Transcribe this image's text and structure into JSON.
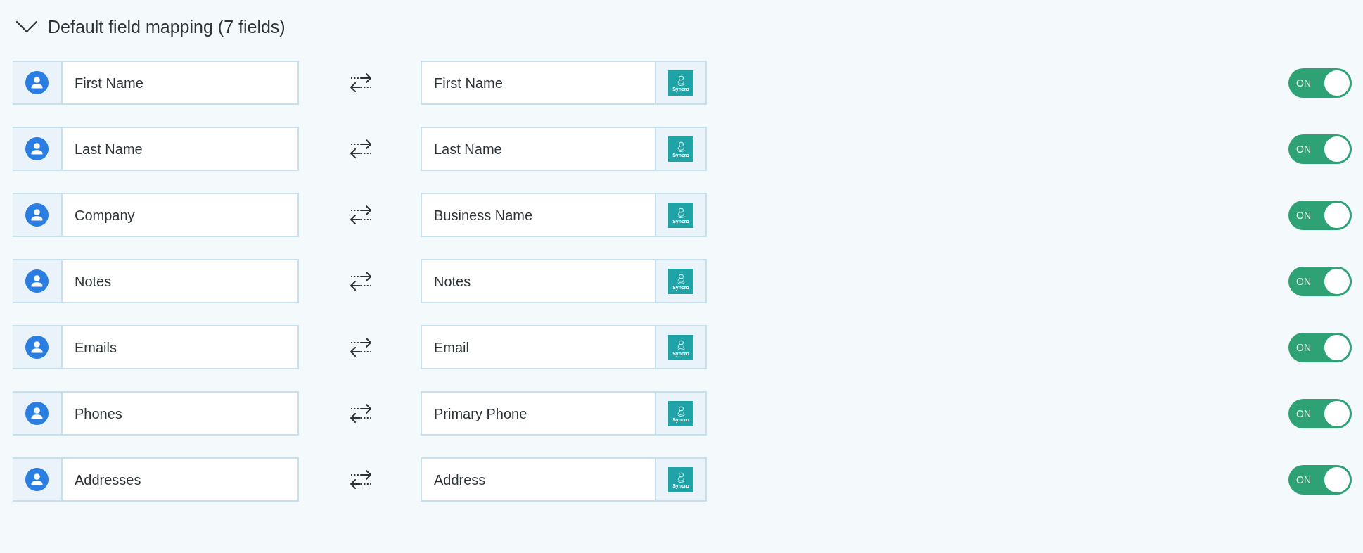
{
  "section": {
    "title": "Default field mapping (7 fields)",
    "expanded": true
  },
  "mappings": [
    {
      "source": {
        "value": "First Name"
      },
      "target": {
        "value": "First Name",
        "logo_text": "Syncro"
      },
      "toggle": {
        "label": "ON",
        "on": true
      }
    },
    {
      "source": {
        "value": "Last Name"
      },
      "target": {
        "value": "Last Name",
        "logo_text": "Syncro"
      },
      "toggle": {
        "label": "ON",
        "on": true
      }
    },
    {
      "source": {
        "value": "Company"
      },
      "target": {
        "value": "Business Name",
        "logo_text": "Syncro"
      },
      "toggle": {
        "label": "ON",
        "on": true
      }
    },
    {
      "source": {
        "value": "Notes"
      },
      "target": {
        "value": "Notes",
        "logo_text": "Syncro"
      },
      "toggle": {
        "label": "ON",
        "on": true
      }
    },
    {
      "source": {
        "value": "Emails"
      },
      "target": {
        "value": "Email",
        "logo_text": "Syncro"
      },
      "toggle": {
        "label": "ON",
        "on": true
      }
    },
    {
      "source": {
        "value": "Phones"
      },
      "target": {
        "value": "Primary Phone",
        "logo_text": "Syncro"
      },
      "toggle": {
        "label": "ON",
        "on": true
      }
    },
    {
      "source": {
        "value": "Addresses"
      },
      "target": {
        "value": "Address",
        "logo_text": "Syncro"
      },
      "toggle": {
        "label": "ON",
        "on": true
      }
    }
  ]
}
